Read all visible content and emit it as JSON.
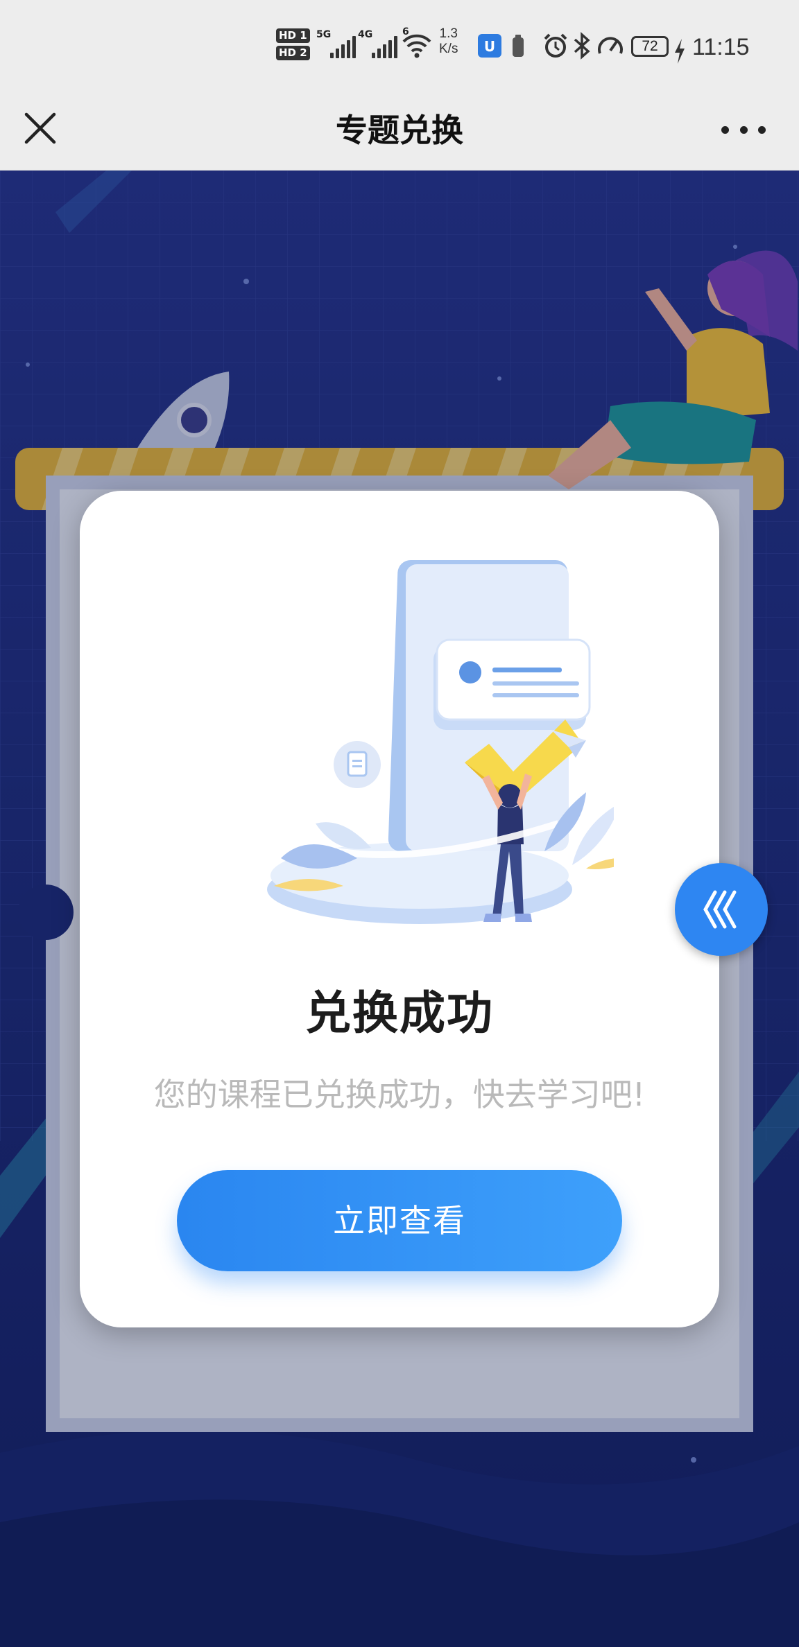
{
  "status_bar": {
    "hd1": "HD 1",
    "hd2": "HD 2",
    "signal1_tag": "5G",
    "signal2_tag": "4G",
    "wifi_tag": "6",
    "speed_value": "1.3",
    "speed_unit": "K/s",
    "battery": "72",
    "time": "11:15"
  },
  "header": {
    "title": "专题兑换",
    "close_icon": "close-icon",
    "more_icon": "more-icon"
  },
  "modal": {
    "title": "兑换成功",
    "subtitle": "您的课程已兑换成功，快去学习吧!",
    "button_label": "立即查看"
  },
  "floating_button": {
    "icon": "chevrons-left-icon"
  },
  "colors": {
    "accent": "#2e86f2",
    "background": "#1a2a6e",
    "title_bar": "#ededed"
  }
}
